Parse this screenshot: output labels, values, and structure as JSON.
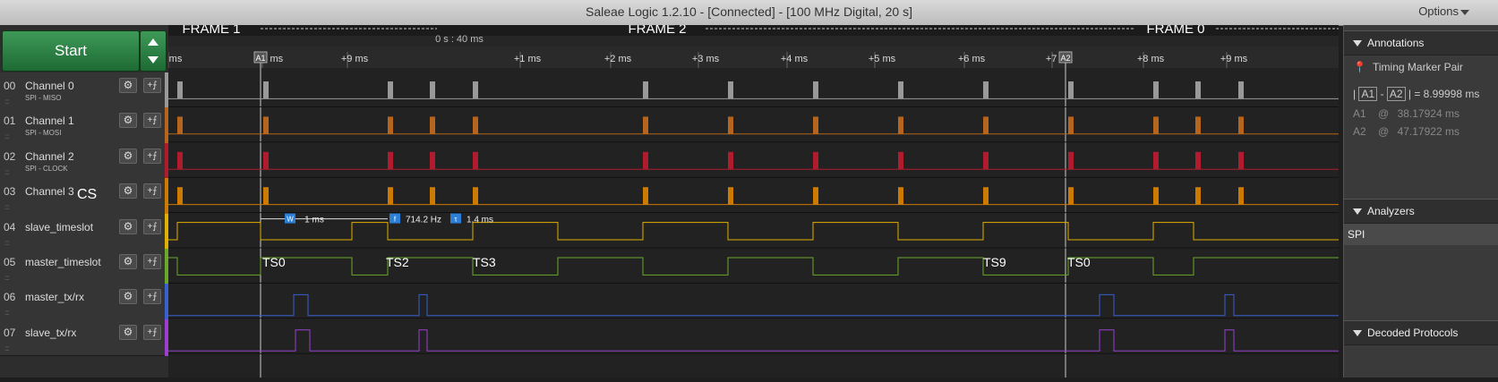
{
  "window": {
    "title": "Saleae Logic 1.2.10 - [Connected] - [100 MHz Digital, 20 s]",
    "options_label": "Options"
  },
  "toolbar": {
    "start_label": "Start"
  },
  "timeline": {
    "frames": [
      "FRAME 1",
      "FRAME 2",
      "FRAME 0"
    ],
    "center_time": "0 s : 40 ms",
    "ticks": [
      "ms",
      "+8 ms",
      "+9 ms",
      "+1 ms",
      "+2 ms",
      "+3 ms",
      "+4 ms",
      "+5 ms",
      "+6 ms",
      "+7 ms",
      "+8 ms",
      "+9 ms"
    ],
    "marker_labels": [
      "A1",
      "A2"
    ],
    "measurements": {
      "width_icon": "W",
      "width": "1 ms",
      "freq_icon": "f",
      "freq": "714.2 Hz",
      "period_icon": "τ",
      "period": "1.4 ms"
    },
    "timeslot_labels": [
      "TS0",
      "TS2",
      "TS3",
      "TS9",
      "TS0"
    ]
  },
  "channels": [
    {
      "num": "00",
      "name": "Channel 0",
      "sub": "SPI - MISO",
      "color": "#999999"
    },
    {
      "num": "01",
      "name": "Channel 1",
      "sub": "SPI - MOSI",
      "color": "#b5651d"
    },
    {
      "num": "02",
      "name": "Channel 2",
      "sub": "SPI - CLOCK",
      "color": "#b01c2e"
    },
    {
      "num": "03",
      "name": "Channel 3",
      "sub": "",
      "color": "#cc7a00"
    },
    {
      "num": "04",
      "name": "slave_timeslot",
      "sub": "",
      "color": "#e0b000"
    },
    {
      "num": "05",
      "name": "master_timeslot",
      "sub": "",
      "color": "#6aa82a"
    },
    {
      "num": "06",
      "name": "master_tx/rx",
      "sub": "",
      "color": "#3a5fcf"
    },
    {
      "num": "07",
      "name": "slave_tx/rx",
      "sub": "",
      "color": "#9a3fd0"
    }
  ],
  "cs_label": "CS",
  "annotations": {
    "header": "Annotations",
    "marker_pair": "Timing Marker Pair",
    "formula_a1": "A1",
    "formula_a2": "A2",
    "diff_value": "= 8.99998 ms",
    "a1_label": "A1",
    "a1_at": "@",
    "a1_value": "38.17924 ms",
    "a2_label": "A2",
    "a2_at": "@",
    "a2_value": "47.17922 ms"
  },
  "analyzers": {
    "header": "Analyzers",
    "items": [
      "SPI"
    ]
  },
  "decoded": {
    "header": "Decoded Protocols"
  }
}
